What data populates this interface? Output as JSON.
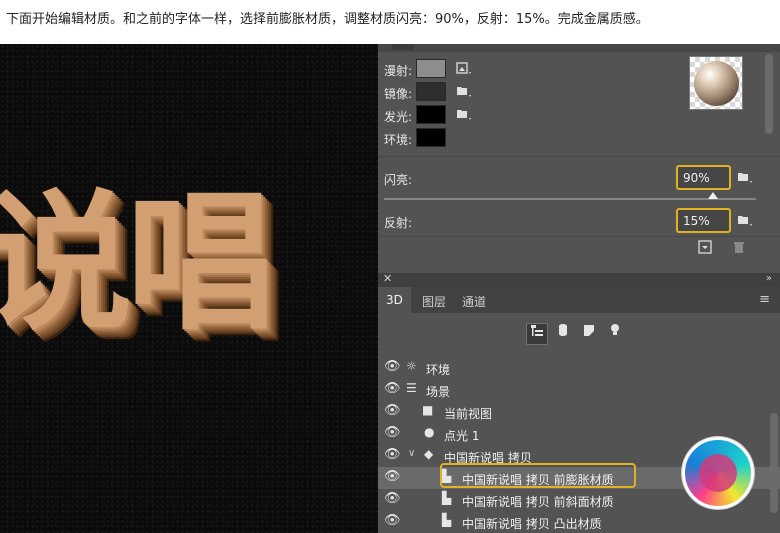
{
  "caption": "下面开始编辑材质。和之前的字体一样，选择前膨胀材质，调整材质闪亮：90%，反射：15%。完成金属质感。",
  "canvas": {
    "text": "说唱"
  },
  "properties": {
    "rows": [
      {
        "label": "漫射:",
        "swatch": "#8d8d8d",
        "icon": "texture-icon"
      },
      {
        "label": "镜像:",
        "swatch": "#2e2e2e",
        "icon": "folder-icon"
      },
      {
        "label": "发光:",
        "swatch": "#000000",
        "icon": "folder-icon"
      },
      {
        "label": "环境:",
        "swatch": "#000000",
        "icon": ""
      }
    ],
    "shine": {
      "label": "闪亮:",
      "value": "90%"
    },
    "reflection": {
      "label": "反射:",
      "value": "15%"
    }
  },
  "panel3d": {
    "tabs": [
      "3D",
      "图层",
      "通道"
    ],
    "active_tab": "3D",
    "tree": [
      {
        "text": "环境",
        "icon": "environment-icon",
        "indent": 0
      },
      {
        "text": "场景",
        "icon": "scene-icon",
        "indent": 0
      },
      {
        "text": "当前视图",
        "icon": "camera-icon",
        "indent": 1
      },
      {
        "text": "点光 1",
        "icon": "light-icon",
        "indent": 1
      },
      {
        "text": "中国新说唱 拷贝",
        "icon": "mesh-icon",
        "indent": 1,
        "expanded": true
      },
      {
        "text": "中国新说唱 拷贝 前膨胀材质",
        "icon": "material-icon",
        "indent": 2,
        "selected": true
      },
      {
        "text": "中国新说唱 拷贝 前斜面材质",
        "icon": "material-icon",
        "indent": 2
      },
      {
        "text": "中国新说唱 拷贝 凸出材质",
        "icon": "material-icon",
        "indent": 2
      }
    ]
  },
  "colors": {
    "highlight_outline": "#e2b020",
    "panel_bg": "#535353",
    "text_3d": "#d19f72"
  }
}
